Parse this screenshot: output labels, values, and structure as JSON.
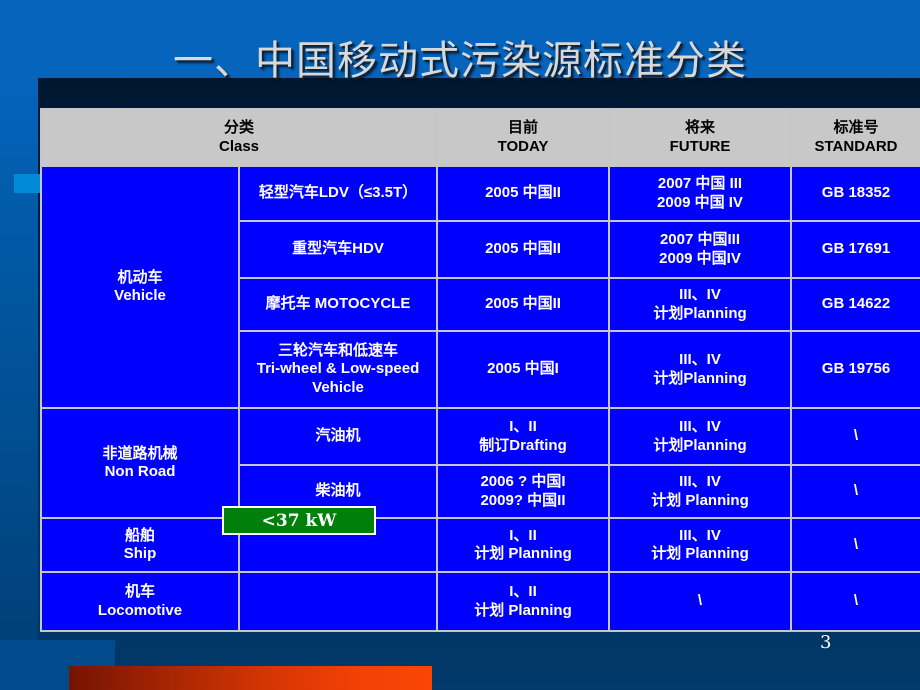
{
  "slide": {
    "title": "一、中国移动式污染源标准分类",
    "page_number": "3",
    "accent_color": "#0089d6",
    "body_cell_color": "#0000ff",
    "header_cell_color": "#c8c8c8",
    "callout_color": "#00800b",
    "bottom_bar_colors": [
      "#751402",
      "#fa4506"
    ]
  },
  "table": {
    "headers": [
      {
        "cn": "分类",
        "en": "Class"
      },
      {
        "cn": "目前",
        "en": "TODAY"
      },
      {
        "cn": "将来",
        "en": "FUTURE"
      },
      {
        "cn": "标准号",
        "en": "STANDARD"
      }
    ],
    "categories": [
      {
        "cn": "机动车",
        "en": "Vehicle",
        "rows": [
          {
            "sub": [
              "轻型汽车LDV（≤3.5T）"
            ],
            "today": [
              "2005 中国II"
            ],
            "future": [
              "2007 中国 III",
              "2009 中国 IV"
            ],
            "standard": "GB 18352"
          },
          {
            "sub": [
              "重型汽车HDV"
            ],
            "today": [
              "2005 中国II"
            ],
            "future": [
              "2007 中国III",
              "2009 中国IV"
            ],
            "standard": "GB 17691"
          },
          {
            "sub": [
              "摩托车 MOTOCYCLE"
            ],
            "today": [
              "2005 中国II"
            ],
            "future": [
              "III、IV",
              "计划Planning"
            ],
            "standard": "GB 14622"
          },
          {
            "sub": [
              "三轮汽车和低速车",
              "Tri-wheel & Low-speed",
              "Vehicle"
            ],
            "today": [
              "2005 中国I"
            ],
            "future": [
              "III、IV",
              "计划Planning"
            ],
            "standard": "GB 19756"
          }
        ]
      },
      {
        "cn": "非道路机械",
        "en": "Non Road",
        "rows": [
          {
            "sub": [
              "汽油机"
            ],
            "today": [
              "I、II",
              "制订Drafting"
            ],
            "future": [
              "III、IV",
              "计划Planning"
            ],
            "standard": "\\"
          },
          {
            "sub": [
              "柴油机"
            ],
            "today": [
              "2006 ? 中国I",
              "2009? 中国II"
            ],
            "future": [
              "III、IV",
              "计划 Planning"
            ],
            "standard": "\\"
          }
        ]
      },
      {
        "cn": "船舶",
        "en": "Ship",
        "rows": [
          {
            "sub": [
              ""
            ],
            "today": [
              "I、II",
              "计划 Planning"
            ],
            "future": [
              "III、IV",
              "计划 Planning"
            ],
            "standard": "\\"
          }
        ]
      },
      {
        "cn": "机车",
        "en": "Locomotive",
        "rows": [
          {
            "sub": [
              ""
            ],
            "today": [
              "I、II",
              "计划 Planning"
            ],
            "future": [
              "\\"
            ],
            "standard": "\\"
          }
        ]
      }
    ]
  },
  "callout": {
    "label": "<37 kW"
  }
}
